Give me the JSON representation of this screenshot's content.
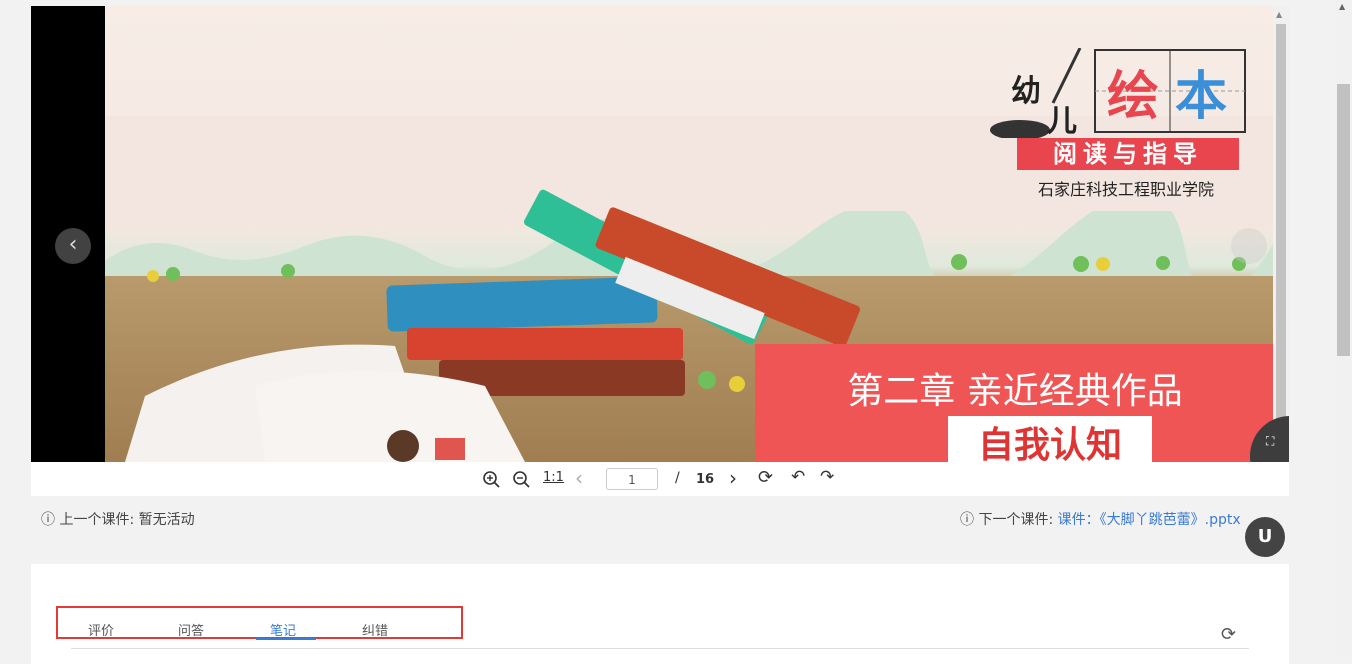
{
  "slide": {
    "logo_you": "幼",
    "logo_er": "儿",
    "logo_hui": "绘",
    "logo_ben": "本",
    "logo_subtitle": "阅读与指导",
    "school": "石家庄科技工程职业学院",
    "chapter_title": "第二章  亲近经典作品",
    "section_title": "自我认知"
  },
  "toolbar": {
    "zoom_in_icon": "zoom-in-icon",
    "zoom_out_icon": "zoom-out-icon",
    "actual_size_label": "1:1",
    "page_current": "1",
    "page_sep": "/",
    "page_total": "16"
  },
  "course_nav": {
    "prev_label": "上一个课件: 暂无活动",
    "next_label": "下一个课件: ",
    "next_link": "课件：《大脚丫跳芭蕾》.pptx"
  },
  "tabs": [
    {
      "label": "评价"
    },
    {
      "label": "问答"
    },
    {
      "label": "笔记"
    },
    {
      "label": "纠错"
    }
  ],
  "active_tab": "笔记",
  "colors": {
    "accent": "#3a7bd5",
    "highlight_border": "#e53935",
    "chapter_bg": "#f05555"
  }
}
